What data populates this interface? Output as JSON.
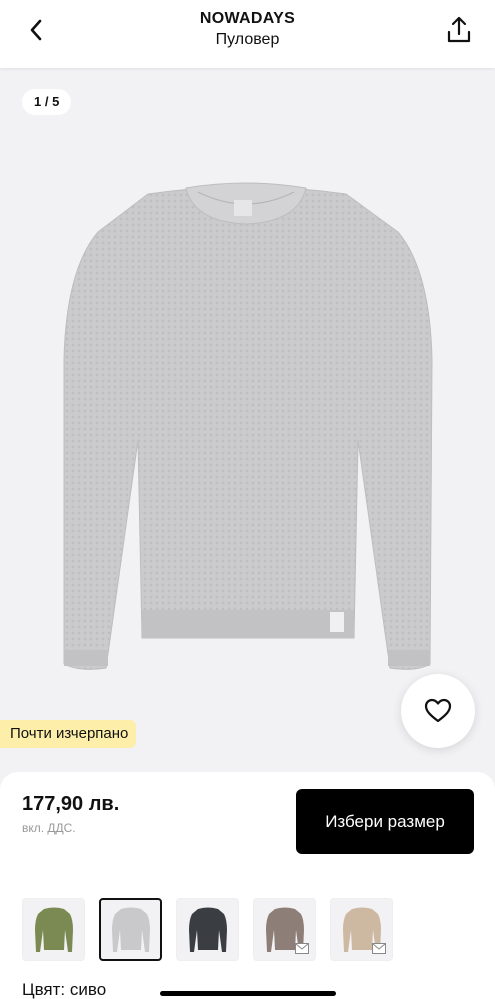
{
  "header": {
    "brand": "NOWADAYS",
    "subtitle": "Пуловер"
  },
  "gallery": {
    "counter": "1 / 5",
    "badge": "Почти изчерпано"
  },
  "purchase": {
    "price": "177,90 лв.",
    "vat_note": "вкл. ДДС.",
    "select_size_label": "Избери размер"
  },
  "variants": {
    "swatches": [
      {
        "name": "olive",
        "color": "#7a8a52",
        "selected": false
      },
      {
        "name": "grey",
        "color": "#c9c9cb",
        "selected": true
      },
      {
        "name": "charcoal",
        "color": "#3a3d42",
        "selected": false
      },
      {
        "name": "taupe",
        "color": "#8d7f78",
        "selected": false
      },
      {
        "name": "beige",
        "color": "#cdb8a2",
        "selected": false
      }
    ],
    "color_label": "Цвят: сиво"
  },
  "colors": {
    "accent": "#000000",
    "badge_bg": "#fdeeaa",
    "product": "#c9c9cb"
  },
  "icons": {
    "back": "chevron-left-icon",
    "share": "share-icon",
    "favorite": "heart-icon"
  }
}
